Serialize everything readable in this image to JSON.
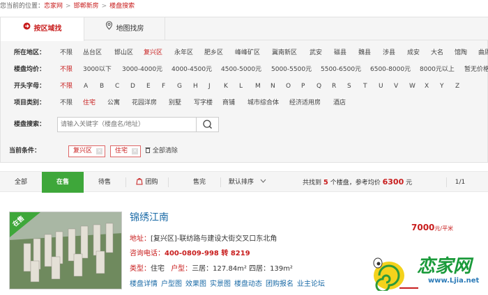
{
  "breadcrumb": {
    "prefix": "您当前的位置：",
    "site": "恋家网",
    "sep": ">",
    "city": "邯郸新房",
    "page": "楼盘搜索"
  },
  "tabs": {
    "by_area": "按区域找",
    "by_map": "地图找房"
  },
  "filters": {
    "area": {
      "label": "所在地区：",
      "options": [
        "不限",
        "丛台区",
        "邯山区",
        "复兴区",
        "永年区",
        "肥乡区",
        "峰峰矿区",
        "冀南新区",
        "武安",
        "磁县",
        "魏县",
        "涉县",
        "成安",
        "大名",
        "馆陶",
        "曲周"
      ],
      "selected": "复兴区"
    },
    "price": {
      "label": "楼盘均价：",
      "options": [
        "不限",
        "3000以下",
        "3000-4000元",
        "4000-4500元",
        "4500-5000元",
        "5000-5500元",
        "5500-6500元",
        "6500-8000元",
        "8000元以上",
        "暂无价格"
      ],
      "selected": "不限"
    },
    "letter": {
      "label": "开头字母：",
      "options": [
        "不限",
        "A",
        "B",
        "C",
        "D",
        "E",
        "F",
        "G",
        "H",
        "J",
        "K",
        "L",
        "M",
        "N",
        "O",
        "P",
        "Q",
        "R",
        "S",
        "T",
        "U",
        "V",
        "W",
        "X",
        "Y",
        "Z"
      ],
      "selected": "不限"
    },
    "type": {
      "label": "项目类别：",
      "options": [
        "不限",
        "住宅",
        "公寓",
        "花园洋房",
        "别墅",
        "写字楼",
        "商铺",
        "城市综合体",
        "经济适用房",
        "酒店"
      ],
      "selected": "住宅"
    }
  },
  "search": {
    "label": "楼盘搜索：",
    "placeholder": "请输入关键字（楼盘名/地址）"
  },
  "conditions": {
    "label": "当前条件：",
    "chips": [
      "复兴区",
      "住宅"
    ],
    "clear": "全部清除"
  },
  "sortbar": {
    "all": "全部",
    "on_sale": "在售",
    "pending": "待售",
    "group": "团购",
    "sold_out": "售完",
    "default_sort": "默认排序",
    "found_prefix": "共找到",
    "count": "5",
    "found_mid": "个楼盘，参考均价",
    "avg_price": "6300",
    "price_unit": "元",
    "page": "1/1"
  },
  "listing": {
    "badge": "在售",
    "name": "锦绣江南",
    "address_label": "地址：",
    "address": "[复兴区]-联纺路与建设大街交叉口东北角",
    "phone_label": "咨询电话：",
    "phone": "400-0809-998 转 8219",
    "type_label": "类型：",
    "type_value": "住宅",
    "layout_label": "户型：",
    "layout_value": "三居：127.84m² 四居：139m²",
    "price": "7000",
    "price_unit": "元/平米",
    "links": [
      "楼盘详情",
      "户型图",
      "效果图",
      "实景图",
      "楼盘动态",
      "团购报名",
      "业主论坛"
    ]
  },
  "logo": {
    "text": "恋家网",
    "url_text": "www.Ljia.net"
  },
  "colors": {
    "accent": "#c81d1d",
    "green": "#3ea73a",
    "link": "#1a6aa6"
  }
}
